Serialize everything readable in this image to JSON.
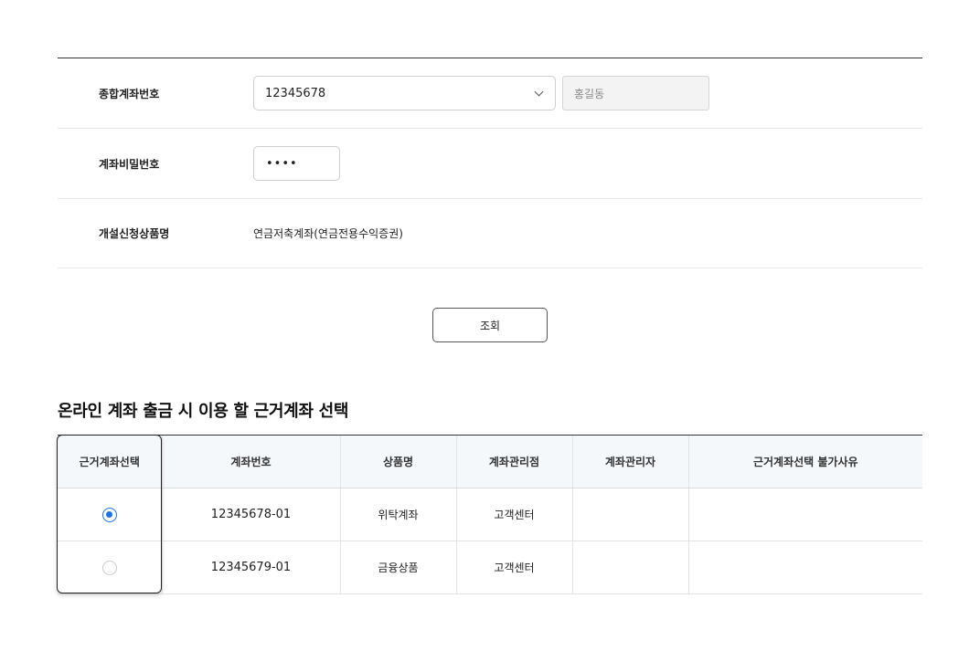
{
  "form": {
    "account_label": "종합계좌번호",
    "account_value": "12345678",
    "owner_name": "홍길동",
    "password_label": "계좌비밀번호",
    "password_value": "••••",
    "product_label": "개설신청상품명",
    "product_value": "연금저축계좌(연금전용수익증권)"
  },
  "search_button_label": "조회",
  "section_title": "온라인 계좌 출금 시 이용 할 근거계좌 선택",
  "table": {
    "headers": [
      "근거계좌선택",
      "계좌번호",
      "상품명",
      "계좌관리점",
      "계좌관리자",
      "근거계좌선택 불가사유"
    ],
    "rows": [
      {
        "selected": true,
        "account_no": "12345678-01",
        "product": "위탁계좌",
        "branch": "고객센터",
        "manager": "",
        "reason": ""
      },
      {
        "selected": false,
        "account_no": "12345679-01",
        "product": "금융상품",
        "branch": "고객센터",
        "manager": "",
        "reason": ""
      }
    ]
  },
  "colors": {
    "accent": "#1a73e8",
    "header_bg": "#f5f8fb"
  }
}
